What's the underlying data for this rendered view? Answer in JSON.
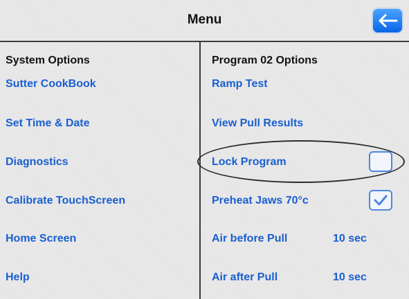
{
  "header": {
    "title": "Menu",
    "back_icon": "back-arrow-icon"
  },
  "left": {
    "heading": "System Options",
    "items": [
      "Sutter CookBook",
      "Set Time & Date",
      "Diagnostics",
      "Calibrate TouchScreen",
      "Home Screen",
      "Help"
    ]
  },
  "right": {
    "heading": "Program 02 Options",
    "ramp_test": "Ramp Test",
    "view_pull_results": "View Pull Results",
    "lock_program": {
      "label": "Lock Program",
      "checked": false
    },
    "preheat_jaws": {
      "label": "Preheat Jaws 70°c",
      "checked": true
    },
    "air_before_pull": {
      "label": "Air before Pull",
      "value": "10 sec"
    },
    "air_after_pull": {
      "label": "Air after Pull",
      "value": "10 sec"
    }
  },
  "colors": {
    "accent": "#1a5fd0",
    "background": "#e9e9e9"
  }
}
